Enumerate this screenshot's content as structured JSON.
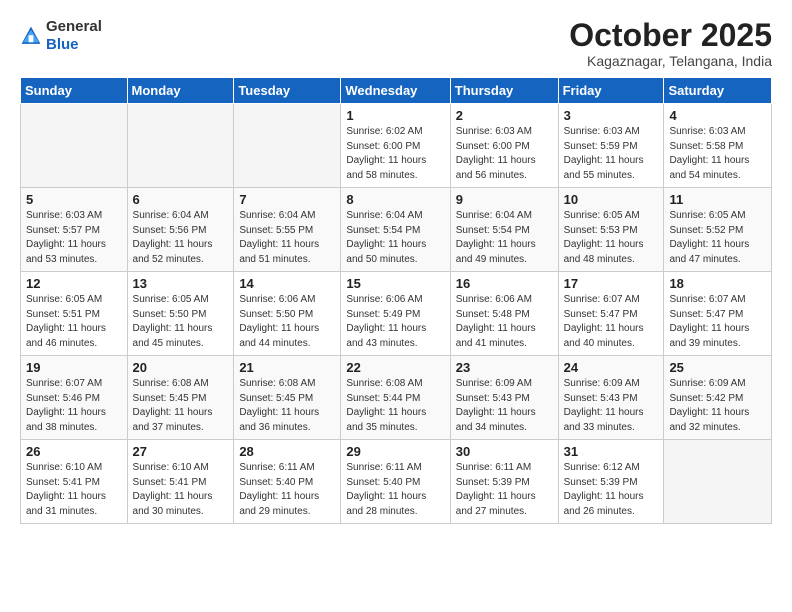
{
  "logo": {
    "general": "General",
    "blue": "Blue"
  },
  "title": "October 2025",
  "location": "Kagaznagar, Telangana, India",
  "days_of_week": [
    "Sunday",
    "Monday",
    "Tuesday",
    "Wednesday",
    "Thursday",
    "Friday",
    "Saturday"
  ],
  "weeks": [
    [
      {
        "day": "",
        "sunrise": "",
        "sunset": "",
        "daylight": ""
      },
      {
        "day": "",
        "sunrise": "",
        "sunset": "",
        "daylight": ""
      },
      {
        "day": "",
        "sunrise": "",
        "sunset": "",
        "daylight": ""
      },
      {
        "day": "1",
        "sunrise": "Sunrise: 6:02 AM",
        "sunset": "Sunset: 6:00 PM",
        "daylight": "Daylight: 11 hours and 58 minutes."
      },
      {
        "day": "2",
        "sunrise": "Sunrise: 6:03 AM",
        "sunset": "Sunset: 6:00 PM",
        "daylight": "Daylight: 11 hours and 56 minutes."
      },
      {
        "day": "3",
        "sunrise": "Sunrise: 6:03 AM",
        "sunset": "Sunset: 5:59 PM",
        "daylight": "Daylight: 11 hours and 55 minutes."
      },
      {
        "day": "4",
        "sunrise": "Sunrise: 6:03 AM",
        "sunset": "Sunset: 5:58 PM",
        "daylight": "Daylight: 11 hours and 54 minutes."
      }
    ],
    [
      {
        "day": "5",
        "sunrise": "Sunrise: 6:03 AM",
        "sunset": "Sunset: 5:57 PM",
        "daylight": "Daylight: 11 hours and 53 minutes."
      },
      {
        "day": "6",
        "sunrise": "Sunrise: 6:04 AM",
        "sunset": "Sunset: 5:56 PM",
        "daylight": "Daylight: 11 hours and 52 minutes."
      },
      {
        "day": "7",
        "sunrise": "Sunrise: 6:04 AM",
        "sunset": "Sunset: 5:55 PM",
        "daylight": "Daylight: 11 hours and 51 minutes."
      },
      {
        "day": "8",
        "sunrise": "Sunrise: 6:04 AM",
        "sunset": "Sunset: 5:54 PM",
        "daylight": "Daylight: 11 hours and 50 minutes."
      },
      {
        "day": "9",
        "sunrise": "Sunrise: 6:04 AM",
        "sunset": "Sunset: 5:54 PM",
        "daylight": "Daylight: 11 hours and 49 minutes."
      },
      {
        "day": "10",
        "sunrise": "Sunrise: 6:05 AM",
        "sunset": "Sunset: 5:53 PM",
        "daylight": "Daylight: 11 hours and 48 minutes."
      },
      {
        "day": "11",
        "sunrise": "Sunrise: 6:05 AM",
        "sunset": "Sunset: 5:52 PM",
        "daylight": "Daylight: 11 hours and 47 minutes."
      }
    ],
    [
      {
        "day": "12",
        "sunrise": "Sunrise: 6:05 AM",
        "sunset": "Sunset: 5:51 PM",
        "daylight": "Daylight: 11 hours and 46 minutes."
      },
      {
        "day": "13",
        "sunrise": "Sunrise: 6:05 AM",
        "sunset": "Sunset: 5:50 PM",
        "daylight": "Daylight: 11 hours and 45 minutes."
      },
      {
        "day": "14",
        "sunrise": "Sunrise: 6:06 AM",
        "sunset": "Sunset: 5:50 PM",
        "daylight": "Daylight: 11 hours and 44 minutes."
      },
      {
        "day": "15",
        "sunrise": "Sunrise: 6:06 AM",
        "sunset": "Sunset: 5:49 PM",
        "daylight": "Daylight: 11 hours and 43 minutes."
      },
      {
        "day": "16",
        "sunrise": "Sunrise: 6:06 AM",
        "sunset": "Sunset: 5:48 PM",
        "daylight": "Daylight: 11 hours and 41 minutes."
      },
      {
        "day": "17",
        "sunrise": "Sunrise: 6:07 AM",
        "sunset": "Sunset: 5:47 PM",
        "daylight": "Daylight: 11 hours and 40 minutes."
      },
      {
        "day": "18",
        "sunrise": "Sunrise: 6:07 AM",
        "sunset": "Sunset: 5:47 PM",
        "daylight": "Daylight: 11 hours and 39 minutes."
      }
    ],
    [
      {
        "day": "19",
        "sunrise": "Sunrise: 6:07 AM",
        "sunset": "Sunset: 5:46 PM",
        "daylight": "Daylight: 11 hours and 38 minutes."
      },
      {
        "day": "20",
        "sunrise": "Sunrise: 6:08 AM",
        "sunset": "Sunset: 5:45 PM",
        "daylight": "Daylight: 11 hours and 37 minutes."
      },
      {
        "day": "21",
        "sunrise": "Sunrise: 6:08 AM",
        "sunset": "Sunset: 5:45 PM",
        "daylight": "Daylight: 11 hours and 36 minutes."
      },
      {
        "day": "22",
        "sunrise": "Sunrise: 6:08 AM",
        "sunset": "Sunset: 5:44 PM",
        "daylight": "Daylight: 11 hours and 35 minutes."
      },
      {
        "day": "23",
        "sunrise": "Sunrise: 6:09 AM",
        "sunset": "Sunset: 5:43 PM",
        "daylight": "Daylight: 11 hours and 34 minutes."
      },
      {
        "day": "24",
        "sunrise": "Sunrise: 6:09 AM",
        "sunset": "Sunset: 5:43 PM",
        "daylight": "Daylight: 11 hours and 33 minutes."
      },
      {
        "day": "25",
        "sunrise": "Sunrise: 6:09 AM",
        "sunset": "Sunset: 5:42 PM",
        "daylight": "Daylight: 11 hours and 32 minutes."
      }
    ],
    [
      {
        "day": "26",
        "sunrise": "Sunrise: 6:10 AM",
        "sunset": "Sunset: 5:41 PM",
        "daylight": "Daylight: 11 hours and 31 minutes."
      },
      {
        "day": "27",
        "sunrise": "Sunrise: 6:10 AM",
        "sunset": "Sunset: 5:41 PM",
        "daylight": "Daylight: 11 hours and 30 minutes."
      },
      {
        "day": "28",
        "sunrise": "Sunrise: 6:11 AM",
        "sunset": "Sunset: 5:40 PM",
        "daylight": "Daylight: 11 hours and 29 minutes."
      },
      {
        "day": "29",
        "sunrise": "Sunrise: 6:11 AM",
        "sunset": "Sunset: 5:40 PM",
        "daylight": "Daylight: 11 hours and 28 minutes."
      },
      {
        "day": "30",
        "sunrise": "Sunrise: 6:11 AM",
        "sunset": "Sunset: 5:39 PM",
        "daylight": "Daylight: 11 hours and 27 minutes."
      },
      {
        "day": "31",
        "sunrise": "Sunrise: 6:12 AM",
        "sunset": "Sunset: 5:39 PM",
        "daylight": "Daylight: 11 hours and 26 minutes."
      },
      {
        "day": "",
        "sunrise": "",
        "sunset": "",
        "daylight": ""
      }
    ]
  ]
}
